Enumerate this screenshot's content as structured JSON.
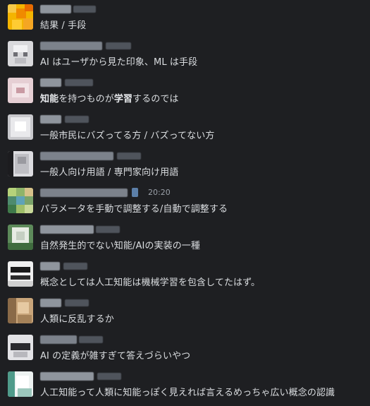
{
  "messages": [
    {
      "text": "結果 / 手段",
      "avatar": "orange-pixel-avatar"
    },
    {
      "text": "AI はユーザから見た印象、ML は手段",
      "avatar": "white-face-avatar"
    },
    {
      "text_bold": "知能",
      "text_middle": "を持つものが",
      "text_bold2": "学習",
      "text_end": "するのでは",
      "avatar": "pink-avatar"
    },
    {
      "text": "一般市民にバズってる方 / バズってない方",
      "avatar": "white-blur-avatar"
    },
    {
      "text": "一般人向け用語 / 専門家向け用語",
      "avatar": "gray-figure-avatar"
    },
    {
      "text": "パラメータを手動で調整する/自動で調整する",
      "timestamp": "20:20",
      "avatar": "green-pixel-avatar"
    },
    {
      "text": "自然発生的でない知能/AIの実装の一種",
      "avatar": "green-white-avatar"
    },
    {
      "text": "概念としては人工知能は機械学習を包含してたはず。",
      "avatar": "black-white-avatar"
    },
    {
      "text": "人類に反乱するか",
      "avatar": "tan-avatar"
    },
    {
      "text": "AI の定義が雑すぎて答えづらいやつ",
      "avatar": "dark-face-avatar"
    },
    {
      "text": "人工知能って人類に知能っぽく見えれば言えるめっちゃ広い概念の認識",
      "avatar": "teal-white-avatar"
    }
  ]
}
